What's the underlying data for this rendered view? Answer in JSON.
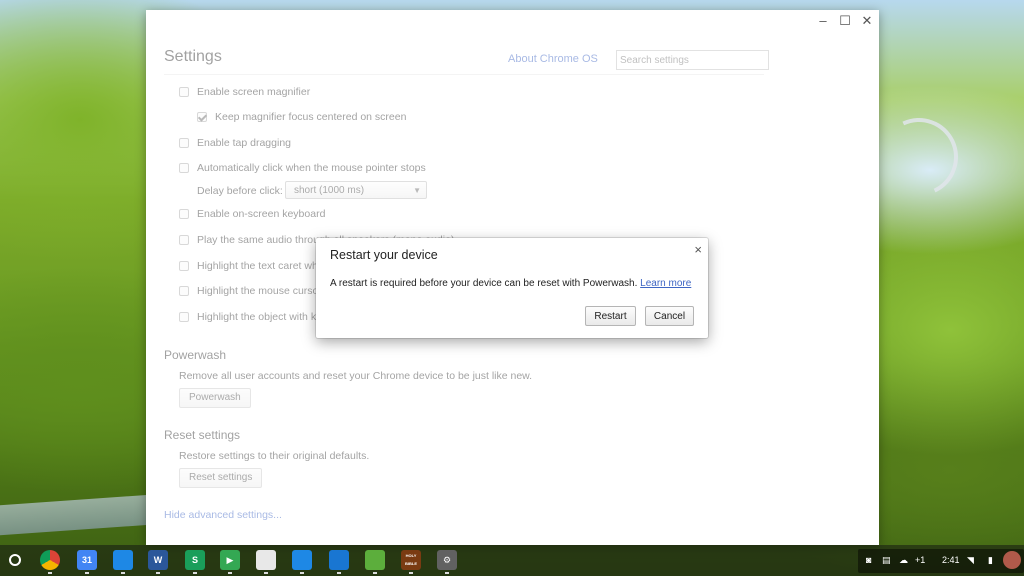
{
  "window": {
    "title": "Settings",
    "controls": {
      "minimize": "–",
      "maximize": "☐",
      "close": "✕"
    }
  },
  "header": {
    "about_link": "About Chrome OS",
    "search_placeholder": "Search settings"
  },
  "accessibility_options": [
    {
      "label": "Enable screen magnifier",
      "checked": false
    },
    {
      "label": "Keep magnifier focus centered on screen",
      "checked": true
    },
    {
      "label": "Enable tap dragging",
      "checked": false
    },
    {
      "label": "Automatically click when the mouse pointer stops",
      "checked": false
    },
    {
      "label": "Enable on-screen keyboard",
      "checked": false
    },
    {
      "label": "Play the same audio through all speakers (mono audio)",
      "checked": false
    },
    {
      "label": "Highlight the text caret when it appears or moves",
      "checked": false
    },
    {
      "label": "Highlight the mouse cursor when it's moving",
      "checked": false
    },
    {
      "label": "Highlight the object with keyboard focus when it changes",
      "checked": false
    }
  ],
  "delay": {
    "label": "Delay before click:",
    "selected": "short (1000 ms)"
  },
  "powerwash": {
    "title": "Powerwash",
    "description": "Remove all user accounts and reset your Chrome device to be just like new.",
    "button": "Powerwash"
  },
  "reset": {
    "title": "Reset settings",
    "description": "Restore settings to their original defaults.",
    "button": "Reset settings"
  },
  "hide_advanced": "Hide advanced settings...",
  "dialog": {
    "title": "Restart your device",
    "message": "A restart is required before your device can be reset with Powerwash.",
    "learn_more": "Learn more",
    "restart": "Restart",
    "cancel": "Cancel",
    "close": "×"
  },
  "shelf": {
    "apps": [
      {
        "name": "chrome",
        "color": "#db4437",
        "glyph": ""
      },
      {
        "name": "calendar",
        "color": "#4285f4",
        "glyph": "31"
      },
      {
        "name": "files",
        "color": "#1e88e5",
        "glyph": ""
      },
      {
        "name": "word",
        "color": "#2b579a",
        "glyph": "W"
      },
      {
        "name": "s-app",
        "color": "#1a9e5a",
        "glyph": "S"
      },
      {
        "name": "play-store",
        "color": "#34a853",
        "glyph": "▶"
      },
      {
        "name": "web-store",
        "color": "#e8e8e8",
        "glyph": ""
      },
      {
        "name": "search",
        "color": "#1e88e5",
        "glyph": ""
      },
      {
        "name": "bookmark",
        "color": "#1976d2",
        "glyph": ""
      },
      {
        "name": "android-app",
        "color": "#5cae3c",
        "glyph": ""
      },
      {
        "name": "holy-bible",
        "color": "#7a3b12",
        "glyph": "HOLY BIBLE"
      },
      {
        "name": "settings",
        "color": "#616161",
        "glyph": "⚙"
      }
    ],
    "tray": {
      "notifications": "+1",
      "time": "2:41"
    }
  }
}
